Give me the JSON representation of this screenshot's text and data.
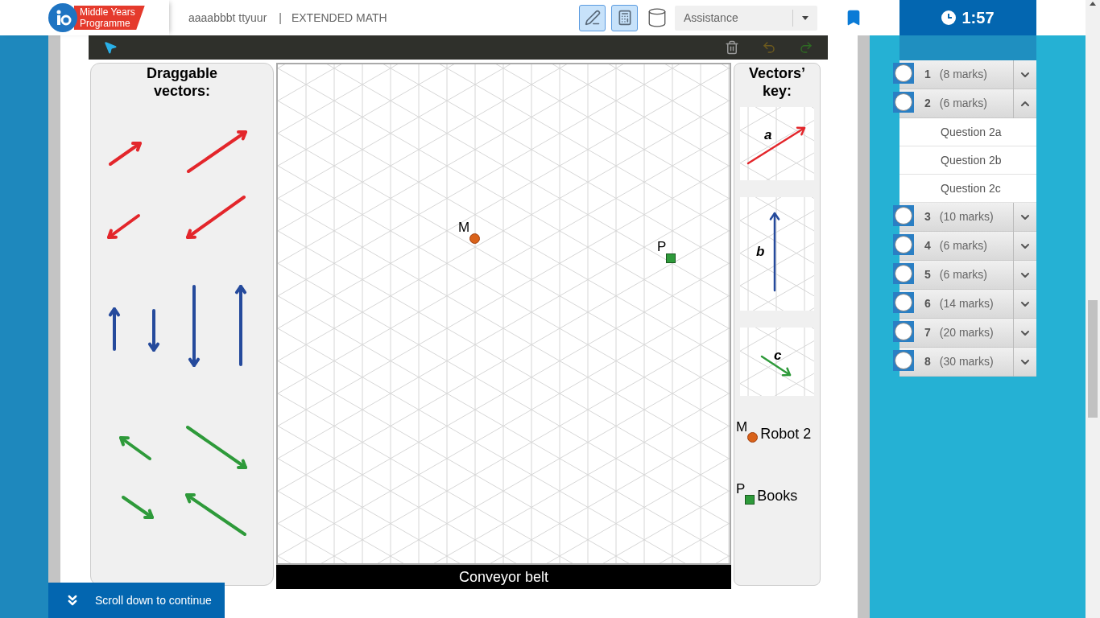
{
  "header": {
    "logo_line1": "Middle Years",
    "logo_line2": "Programme",
    "candidate": "aaaabbbt ttyuur",
    "separator": "|",
    "subject": "EXTENDED MATH",
    "tools": [
      {
        "kind": "pen",
        "selected": true
      },
      {
        "kind": "calculator",
        "selected": true
      },
      {
        "kind": "cylinder",
        "selected": false
      }
    ],
    "assistance": "Assistance",
    "timer": "1:57"
  },
  "questions": [
    {
      "number": "1",
      "marks": "(8 marks)",
      "expanded": false
    },
    {
      "number": "2",
      "marks": "(6 marks)",
      "expanded": true,
      "children": [
        {
          "label": "Question 2a"
        },
        {
          "label": "Question 2b"
        },
        {
          "label": "Question 2c"
        }
      ]
    },
    {
      "number": "3",
      "marks": "(10 marks)",
      "expanded": false
    },
    {
      "number": "4",
      "marks": "(6 marks)",
      "expanded": false
    },
    {
      "number": "5",
      "marks": "(6 marks)",
      "expanded": false
    },
    {
      "number": "6",
      "marks": "(14 marks)",
      "expanded": false
    },
    {
      "number": "7",
      "marks": "(20 marks)",
      "expanded": false
    },
    {
      "number": "8",
      "marks": "(30 marks)",
      "expanded": false
    }
  ],
  "workspace": {
    "draggable_title": "Draggable vectors:",
    "key_title": "Vectors’ key:",
    "key_vectors": [
      {
        "label": "a",
        "kind": "diagonal-up"
      },
      {
        "label": "b",
        "kind": "vertical"
      },
      {
        "label": "c",
        "kind": "diagonal-down"
      }
    ],
    "legend": [
      {
        "letter": "M",
        "label": "Robot 2",
        "kind": "dot"
      },
      {
        "letter": "P",
        "label": "Books",
        "kind": "square"
      }
    ],
    "points": [
      {
        "label": "M",
        "kind": "dot"
      },
      {
        "label": "P",
        "kind": "square"
      }
    ],
    "belt": "Conveyor belt"
  },
  "scroll_banner": "Scroll down to continue"
}
